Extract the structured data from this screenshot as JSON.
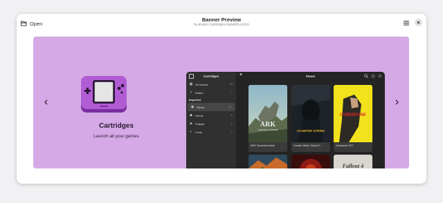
{
  "header": {
    "open_label": "Open",
    "title": "Banner Preview",
    "subtitle": "hu.kramo.Cartridges.metainfo.xml.in"
  },
  "banner": {
    "background": "#d4a9e6",
    "app_name": "Cartridges",
    "tagline": "Launch all your games"
  },
  "screenshot": {
    "sidebar": {
      "title": "Cartridges",
      "items": [
        {
          "label": "All Games",
          "count": "33"
        },
        {
          "label": "Added",
          "count": "7"
        }
      ],
      "section_label": "Imported",
      "sources": [
        {
          "label": "Steam",
          "count": "13",
          "icon": "steam-icon"
        },
        {
          "label": "Heroic",
          "count": "6",
          "icon": "heroic-icon"
        },
        {
          "label": "Flatpak",
          "count": "2",
          "icon": "flatpak-icon"
        },
        {
          "label": "Lutris",
          "count": "1",
          "icon": "lutris-icon"
        }
      ]
    },
    "main": {
      "title": "Steam",
      "games": [
        {
          "name": "ARK: Survival Evolved"
        },
        {
          "name": "Counter-Strike: Global O..."
        },
        {
          "name": "Cyberpunk 2077"
        }
      ],
      "cover_texts": {
        "ark": "ARK",
        "ark_sub": "SURVIVAL EVOLVED",
        "csgo": "COUNTER STRIKE",
        "cyberpunk": "CYBERPUNK",
        "fallout": "Fallout 4"
      }
    }
  }
}
